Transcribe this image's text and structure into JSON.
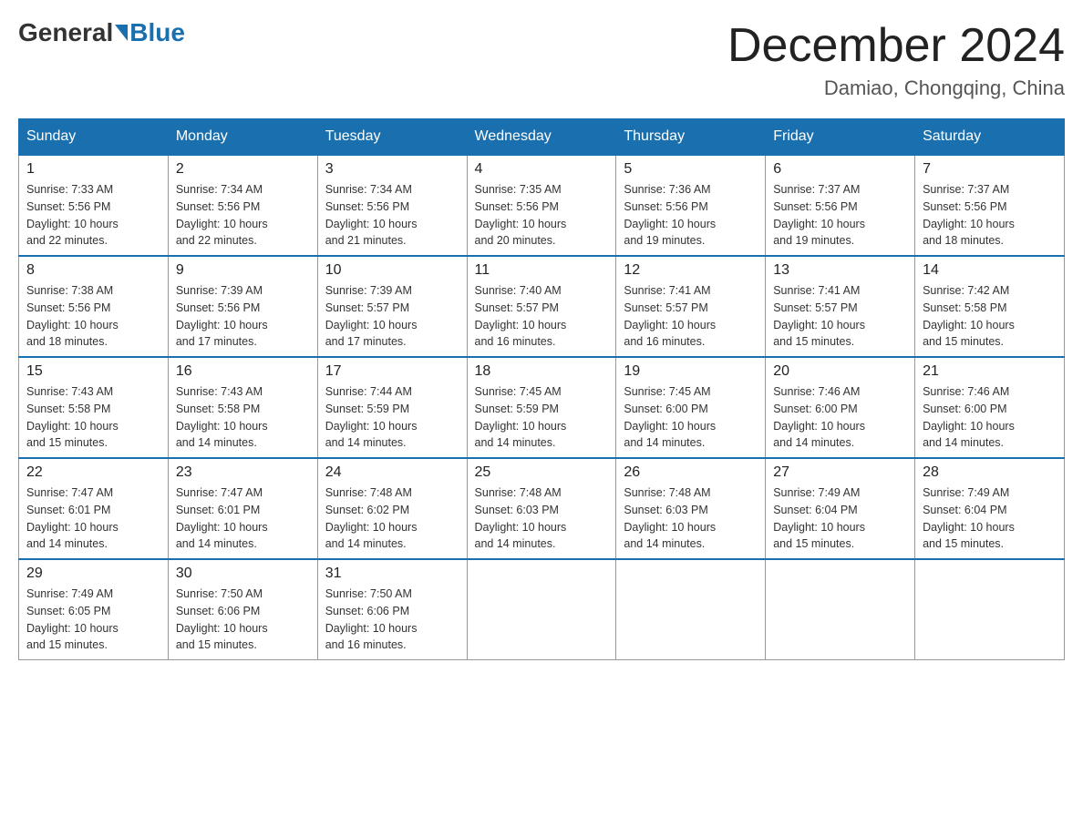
{
  "header": {
    "logo_general": "General",
    "logo_blue": "Blue",
    "month_title": "December 2024",
    "location": "Damiao, Chongqing, China"
  },
  "days_of_week": [
    "Sunday",
    "Monday",
    "Tuesday",
    "Wednesday",
    "Thursday",
    "Friday",
    "Saturday"
  ],
  "weeks": [
    [
      {
        "day": "1",
        "sunrise": "7:33 AM",
        "sunset": "5:56 PM",
        "daylight": "10 hours and 22 minutes."
      },
      {
        "day": "2",
        "sunrise": "7:34 AM",
        "sunset": "5:56 PM",
        "daylight": "10 hours and 22 minutes."
      },
      {
        "day": "3",
        "sunrise": "7:34 AM",
        "sunset": "5:56 PM",
        "daylight": "10 hours and 21 minutes."
      },
      {
        "day": "4",
        "sunrise": "7:35 AM",
        "sunset": "5:56 PM",
        "daylight": "10 hours and 20 minutes."
      },
      {
        "day": "5",
        "sunrise": "7:36 AM",
        "sunset": "5:56 PM",
        "daylight": "10 hours and 19 minutes."
      },
      {
        "day": "6",
        "sunrise": "7:37 AM",
        "sunset": "5:56 PM",
        "daylight": "10 hours and 19 minutes."
      },
      {
        "day": "7",
        "sunrise": "7:37 AM",
        "sunset": "5:56 PM",
        "daylight": "10 hours and 18 minutes."
      }
    ],
    [
      {
        "day": "8",
        "sunrise": "7:38 AM",
        "sunset": "5:56 PM",
        "daylight": "10 hours and 18 minutes."
      },
      {
        "day": "9",
        "sunrise": "7:39 AM",
        "sunset": "5:56 PM",
        "daylight": "10 hours and 17 minutes."
      },
      {
        "day": "10",
        "sunrise": "7:39 AM",
        "sunset": "5:57 PM",
        "daylight": "10 hours and 17 minutes."
      },
      {
        "day": "11",
        "sunrise": "7:40 AM",
        "sunset": "5:57 PM",
        "daylight": "10 hours and 16 minutes."
      },
      {
        "day": "12",
        "sunrise": "7:41 AM",
        "sunset": "5:57 PM",
        "daylight": "10 hours and 16 minutes."
      },
      {
        "day": "13",
        "sunrise": "7:41 AM",
        "sunset": "5:57 PM",
        "daylight": "10 hours and 15 minutes."
      },
      {
        "day": "14",
        "sunrise": "7:42 AM",
        "sunset": "5:58 PM",
        "daylight": "10 hours and 15 minutes."
      }
    ],
    [
      {
        "day": "15",
        "sunrise": "7:43 AM",
        "sunset": "5:58 PM",
        "daylight": "10 hours and 15 minutes."
      },
      {
        "day": "16",
        "sunrise": "7:43 AM",
        "sunset": "5:58 PM",
        "daylight": "10 hours and 14 minutes."
      },
      {
        "day": "17",
        "sunrise": "7:44 AM",
        "sunset": "5:59 PM",
        "daylight": "10 hours and 14 minutes."
      },
      {
        "day": "18",
        "sunrise": "7:45 AM",
        "sunset": "5:59 PM",
        "daylight": "10 hours and 14 minutes."
      },
      {
        "day": "19",
        "sunrise": "7:45 AM",
        "sunset": "6:00 PM",
        "daylight": "10 hours and 14 minutes."
      },
      {
        "day": "20",
        "sunrise": "7:46 AM",
        "sunset": "6:00 PM",
        "daylight": "10 hours and 14 minutes."
      },
      {
        "day": "21",
        "sunrise": "7:46 AM",
        "sunset": "6:00 PM",
        "daylight": "10 hours and 14 minutes."
      }
    ],
    [
      {
        "day": "22",
        "sunrise": "7:47 AM",
        "sunset": "6:01 PM",
        "daylight": "10 hours and 14 minutes."
      },
      {
        "day": "23",
        "sunrise": "7:47 AM",
        "sunset": "6:01 PM",
        "daylight": "10 hours and 14 minutes."
      },
      {
        "day": "24",
        "sunrise": "7:48 AM",
        "sunset": "6:02 PM",
        "daylight": "10 hours and 14 minutes."
      },
      {
        "day": "25",
        "sunrise": "7:48 AM",
        "sunset": "6:03 PM",
        "daylight": "10 hours and 14 minutes."
      },
      {
        "day": "26",
        "sunrise": "7:48 AM",
        "sunset": "6:03 PM",
        "daylight": "10 hours and 14 minutes."
      },
      {
        "day": "27",
        "sunrise": "7:49 AM",
        "sunset": "6:04 PM",
        "daylight": "10 hours and 15 minutes."
      },
      {
        "day": "28",
        "sunrise": "7:49 AM",
        "sunset": "6:04 PM",
        "daylight": "10 hours and 15 minutes."
      }
    ],
    [
      {
        "day": "29",
        "sunrise": "7:49 AM",
        "sunset": "6:05 PM",
        "daylight": "10 hours and 15 minutes."
      },
      {
        "day": "30",
        "sunrise": "7:50 AM",
        "sunset": "6:06 PM",
        "daylight": "10 hours and 15 minutes."
      },
      {
        "day": "31",
        "sunrise": "7:50 AM",
        "sunset": "6:06 PM",
        "daylight": "10 hours and 16 minutes."
      },
      null,
      null,
      null,
      null
    ]
  ],
  "labels": {
    "sunrise_label": "Sunrise:",
    "sunset_label": "Sunset:",
    "daylight_label": "Daylight:"
  }
}
